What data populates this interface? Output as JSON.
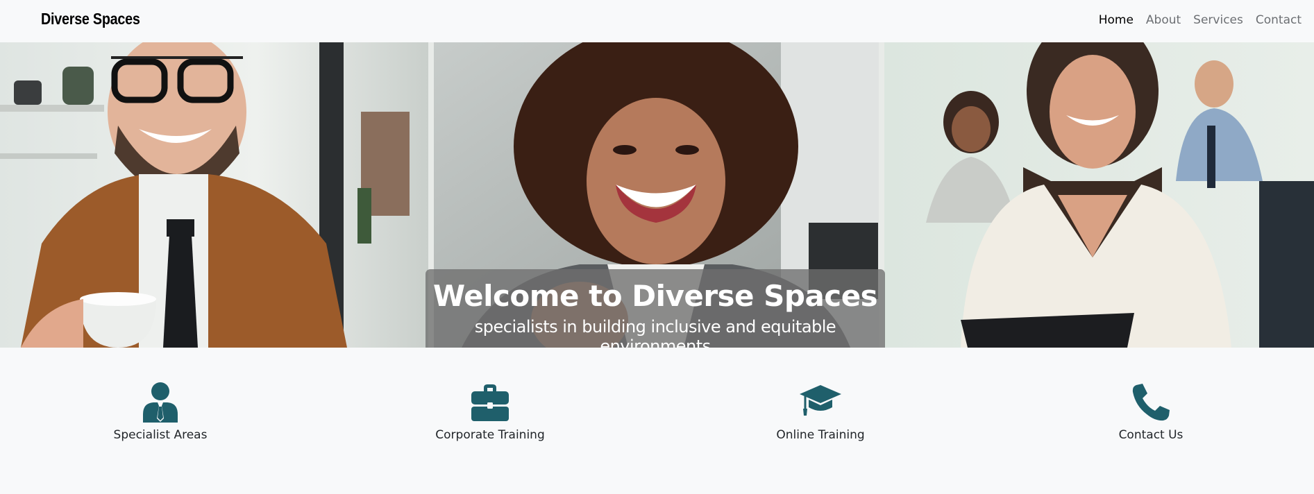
{
  "navbar": {
    "brand": "Diverse Spaces",
    "links": [
      {
        "label": "Home",
        "active": true
      },
      {
        "label": "About",
        "active": false
      },
      {
        "label": "Services",
        "active": false
      },
      {
        "label": "Contact",
        "active": false
      }
    ]
  },
  "hero": {
    "title": "Welcome to Diverse Spaces",
    "subtitle": "specialists in building inclusive and equitable environments"
  },
  "features": [
    {
      "label": "Specialist Areas",
      "icon": "user-tie-icon"
    },
    {
      "label": "Corporate Training",
      "icon": "briefcase-icon"
    },
    {
      "label": "Online Training",
      "icon": "graduation-cap-icon"
    },
    {
      "label": "Contact Us",
      "icon": "phone-icon"
    }
  ],
  "colors": {
    "accent": "#1f5f6b",
    "background": "#f8f9fa",
    "caption_overlay": "#6e6e6e"
  }
}
